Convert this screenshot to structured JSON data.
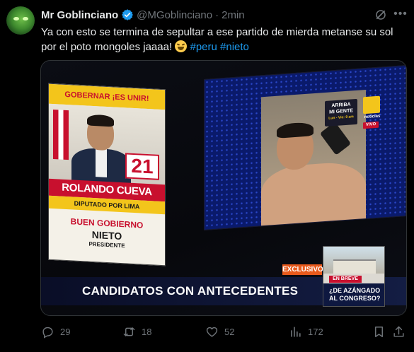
{
  "tweet": {
    "author_name": "Mr Goblinciano",
    "handle": "@MGoblinciano",
    "separator": "·",
    "time": "2min",
    "text_main": "Ya con esto se termina de sepultar a ese partido de mierda metanse su sol por el poto mongoles jaaaa!",
    "hashtag_1": "#peru",
    "hashtag_2": "#nieto",
    "emoji": "laughing-face"
  },
  "media": {
    "poster": {
      "top_text": "GOBERNAR ¡ES UNIR!",
      "number": "21",
      "candidate_name": "ROLANDO CUEVA",
      "role": "DIPUTADO POR LIMA",
      "party_line1": "BUEN GOBIERNO",
      "party_line2": "NIETO",
      "party_line3": "PRESIDENTE"
    },
    "broadcast": {
      "show_logo_line1": "ARRIBA",
      "show_logo_line2": "MI GENTE",
      "show_schedule": "Lun - Vie: 9 am",
      "network_label": "noticias",
      "live_label": "VIVO",
      "exclusive_label": "EXCLUSIVO",
      "headline": "CANDIDATOS CON ANTECEDENTES",
      "breve_label": "EN BREVE",
      "breve_line1": "¿DE AZÁNGADO",
      "breve_line2": "AL CONGRESO?"
    }
  },
  "actions": {
    "replies": "29",
    "reposts": "18",
    "likes": "52",
    "views": "172"
  }
}
